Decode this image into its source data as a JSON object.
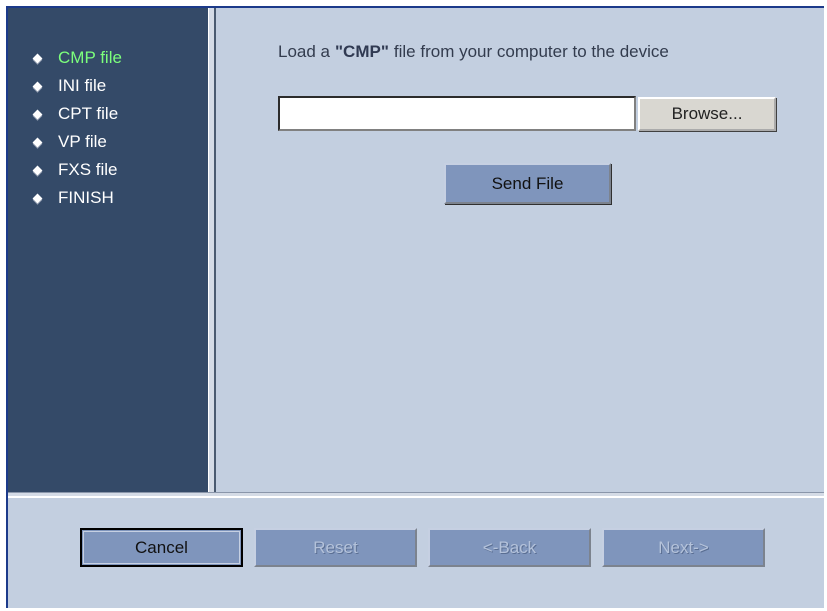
{
  "sidebar": {
    "items": [
      {
        "label": "CMP file",
        "active": true
      },
      {
        "label": "INI file",
        "active": false
      },
      {
        "label": "CPT file",
        "active": false
      },
      {
        "label": "VP file",
        "active": false
      },
      {
        "label": "FXS file",
        "active": false
      },
      {
        "label": "FINISH",
        "active": false
      }
    ]
  },
  "main": {
    "instruction_prefix": "Load a",
    "instruction_bold": "\"CMP\"",
    "instruction_suffix": "file from your computer to the device",
    "file_input_value": "",
    "browse_label": "Browse...",
    "send_label": "Send File"
  },
  "footer": {
    "cancel_label": "Cancel",
    "reset_label": "Reset",
    "back_label": "<-Back",
    "next_label": "Next->"
  },
  "colors": {
    "background": "#c3cfe0",
    "sidebar": "#344a68",
    "active_item": "#7cff7c",
    "button": "#7f95bc"
  }
}
